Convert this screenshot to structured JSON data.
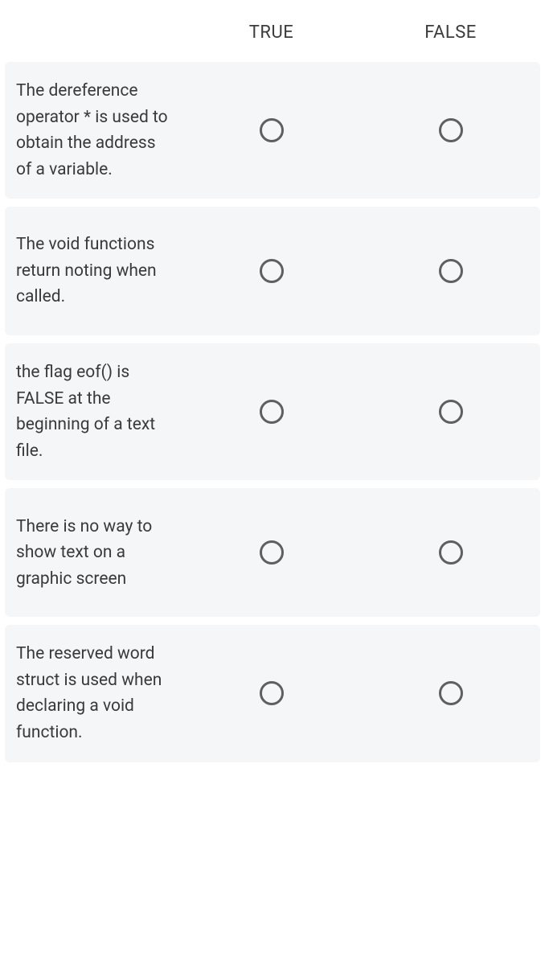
{
  "headers": {
    "true": "TRUE",
    "false": "FALSE"
  },
  "questions": [
    {
      "text": "The dereference operator * is used to obtain the address of a variable."
    },
    {
      "text": "The void functions return noting when called."
    },
    {
      "text": "the flag eof() is FALSE at the beginning of a text file."
    },
    {
      "text": "There is no way to show text on a graphic screen"
    },
    {
      "text": "The reserved word struct is used when declaring a void function."
    }
  ]
}
